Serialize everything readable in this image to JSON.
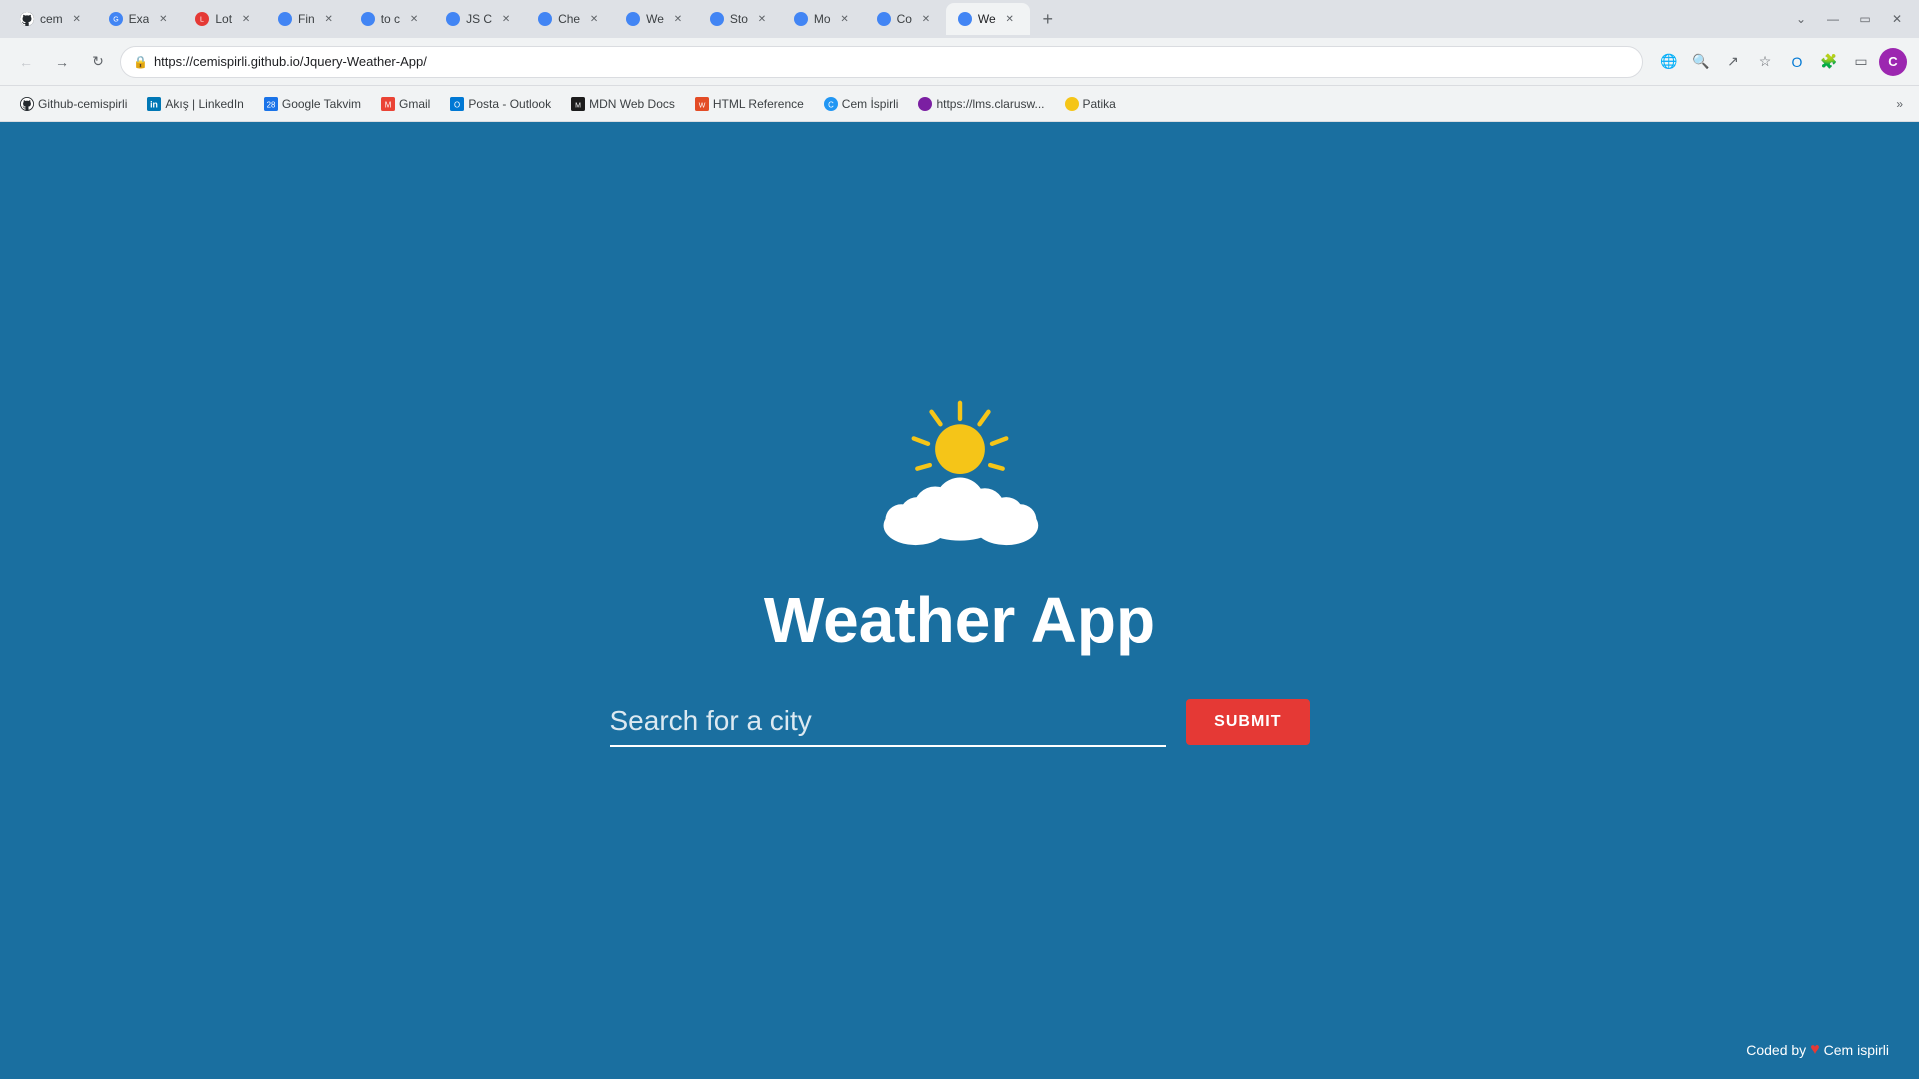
{
  "browser": {
    "tabs": [
      {
        "id": 1,
        "favicon_type": "github",
        "title": "cem",
        "active": false
      },
      {
        "id": 2,
        "favicon_type": "globe",
        "title": "Exa",
        "active": false
      },
      {
        "id": 3,
        "favicon_type": "lotide",
        "title": "Lot",
        "active": false
      },
      {
        "id": 4,
        "favicon_type": "globe",
        "title": "Fin",
        "active": false
      },
      {
        "id": 5,
        "favicon_type": "globe",
        "title": "to c",
        "active": false
      },
      {
        "id": 6,
        "favicon_type": "globe",
        "title": "JS C",
        "active": false
      },
      {
        "id": 7,
        "favicon_type": "globe",
        "title": "Che",
        "active": false
      },
      {
        "id": 8,
        "favicon_type": "globe",
        "title": "We",
        "active": false
      },
      {
        "id": 9,
        "favicon_type": "globe",
        "title": "Sto",
        "active": false
      },
      {
        "id": 10,
        "favicon_type": "globe",
        "title": "Mo",
        "active": false
      },
      {
        "id": 11,
        "favicon_type": "globe",
        "title": "Co",
        "active": false
      },
      {
        "id": 12,
        "favicon_type": "globe",
        "title": "We",
        "active": true
      }
    ],
    "address": "https://cemispirli.github.io/Jquery-Weather-App/",
    "profile_initial": "C"
  },
  "bookmarks": [
    {
      "label": "Github-cemispirli"
    },
    {
      "label": "Akış | LinkedIn"
    },
    {
      "label": "Google Takvim"
    },
    {
      "label": "Gmail"
    },
    {
      "label": "Posta - Outlook"
    },
    {
      "label": "MDN Web Docs"
    },
    {
      "label": "HTML Reference"
    },
    {
      "label": "Cem İspirli"
    },
    {
      "label": "https://lms.clarusw..."
    },
    {
      "label": "Patika"
    }
  ],
  "app": {
    "title": "Weather App",
    "search_placeholder": "Search for a city",
    "submit_label": "SUBMIT"
  },
  "footer": {
    "prefix": "Coded by",
    "author": "Cem ispirli"
  }
}
